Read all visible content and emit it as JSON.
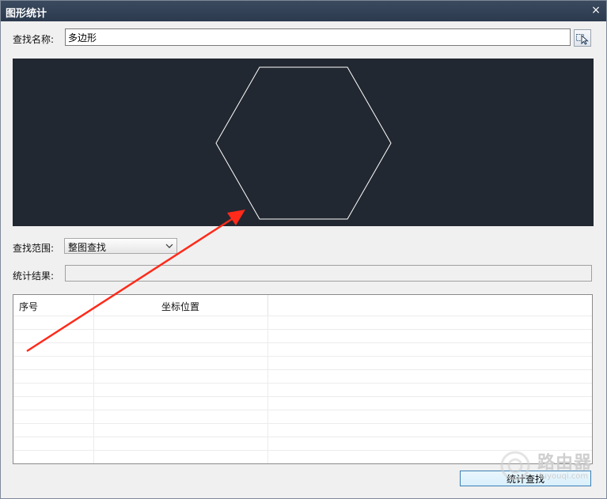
{
  "window": {
    "title": "图形统计",
    "close_glyph": "×"
  },
  "search": {
    "label": "查找名称:",
    "value": "多边形",
    "pick_icon": "cursor-select-icon"
  },
  "preview": {
    "shape": "hexagon",
    "background": "#222831",
    "stroke": "#ffffff"
  },
  "scope": {
    "label": "查找范围:",
    "selected": "整图查找"
  },
  "result": {
    "label": "统计结果:",
    "value": ""
  },
  "table": {
    "columns": [
      "序号",
      "坐标位置"
    ],
    "rows": []
  },
  "find_button": {
    "label": "统计查找"
  },
  "annotation": {
    "color": "#ff2a1a"
  },
  "watermark": {
    "text": "路由器",
    "sub": "luyouqi.com"
  }
}
